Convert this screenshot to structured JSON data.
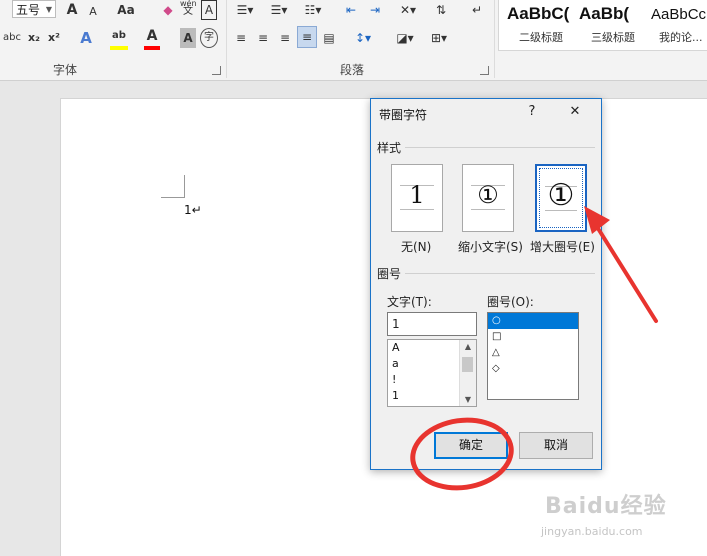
{
  "ribbon": {
    "font_size_value": "五号",
    "font_group_label": "字体",
    "paragraph_group_label": "段落",
    "text_effects_glyph": "A",
    "highlight_glyph": "ab",
    "font_color_glyph": "A",
    "shading_glyph": "A",
    "enclose_char_glyph": "字",
    "grow_font_glyph": "A",
    "shrink_font_glyph": "A",
    "change_case_glyph": "Aa",
    "phonetic_top": "wén",
    "phonetic_bottom": "文",
    "char_border_glyph": "A",
    "strikethrough_glyph": "abc",
    "subscript_glyph": "x₂",
    "superscript_glyph": "x²",
    "styles": [
      {
        "preview": "AaBbC(",
        "name": "二级标题"
      },
      {
        "preview": "AaBb(",
        "name": "三级标题"
      },
      {
        "preview": "AaBbCc",
        "name": "我的论..."
      }
    ],
    "colors": {
      "highlight": "#ffff00",
      "font_color": "#ff0000"
    }
  },
  "document": {
    "text": "1↵"
  },
  "dialog": {
    "title": "带圈字符",
    "help_glyph": "?",
    "close_glyph": "✕",
    "style_section": "样式",
    "style_options": [
      {
        "glyph": "1",
        "label": "无(N)"
      },
      {
        "glyph": "①",
        "label": "缩小文字(S)"
      },
      {
        "glyph": "①",
        "label": "增大圈号(E)"
      }
    ],
    "selected_style": "增大圈号(E)",
    "enclosure_section": "圈号",
    "text_label": "文字(T):",
    "text_value": "1",
    "text_options": [
      "A",
      "a",
      "!",
      "1"
    ],
    "enclosure_label": "圈号(O):",
    "enclosure_options": [
      "○",
      "□",
      "△",
      "◇"
    ],
    "selected_enclosure": "○",
    "ok_label": "确定",
    "cancel_label": "取消"
  },
  "watermark": {
    "logo": "Baidu经验",
    "url": "jingyan.baidu.com"
  },
  "colors": {
    "accent": "#0078d7",
    "annotation": "#e8342f"
  }
}
